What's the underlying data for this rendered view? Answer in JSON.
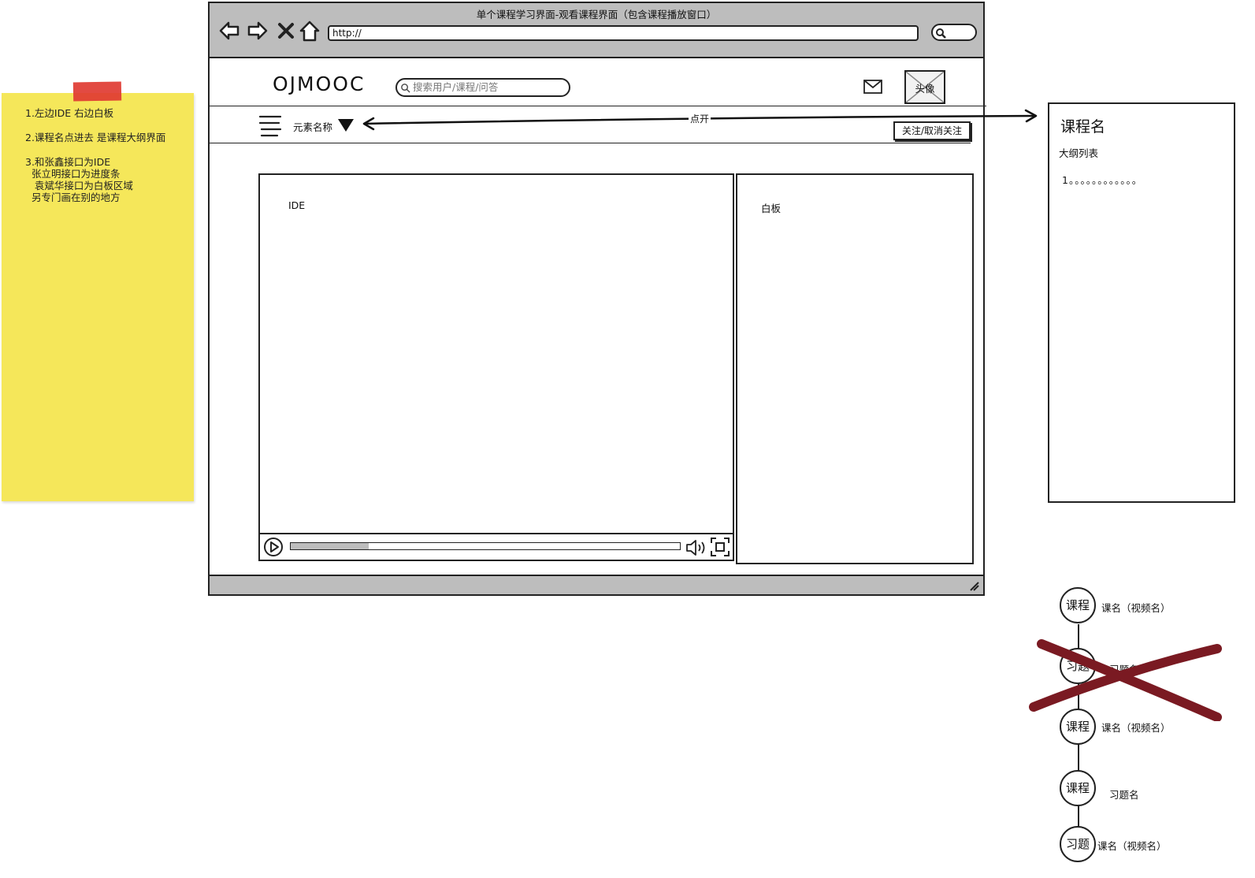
{
  "notes": {
    "line1": "1.左边IDE 右边白板",
    "line2": "2.课程名点进去 是课程大纲界面",
    "line3": "3.和张鑫接口为IDE",
    "line4": "  张立明接口为进度条",
    "line5": "   袁斌华接口为白板区域",
    "line6": "  另专门画在别的地方"
  },
  "browser": {
    "title": "单个课程学习界面-观看课程界面（包含课程播放窗口）",
    "url": "http://"
  },
  "header": {
    "logo": "OJMOOC",
    "search_placeholder": "搜索用户/课程/问答",
    "avatar_label": "头像"
  },
  "subnav": {
    "element_name": "元素名称",
    "follow_label": "关注/取消关注"
  },
  "panels": {
    "ide_label": "IDE",
    "whiteboard_label": "白板",
    "progress": 0.2
  },
  "annotation": {
    "open_label": "点开"
  },
  "outline": {
    "title": "课程名",
    "subtitle": "大纲列表",
    "item": "1。。。。。。。。。。。。"
  },
  "timeline": [
    {
      "node": "课程",
      "label": "课名（视频名）",
      "crossed": false
    },
    {
      "node": "习题",
      "label": "习题名",
      "crossed": true
    },
    {
      "node": "课程",
      "label": "课名（视频名）",
      "crossed": false
    },
    {
      "node": "课程",
      "label": "习题名",
      "crossed": false
    },
    {
      "node": "习题",
      "label": "课名（视频名）",
      "crossed": false
    }
  ],
  "colors": {
    "sticky": "#f5e75a",
    "tape": "#e03b32",
    "chrome": "#bdbdbd",
    "cross": "#7a1a22"
  }
}
